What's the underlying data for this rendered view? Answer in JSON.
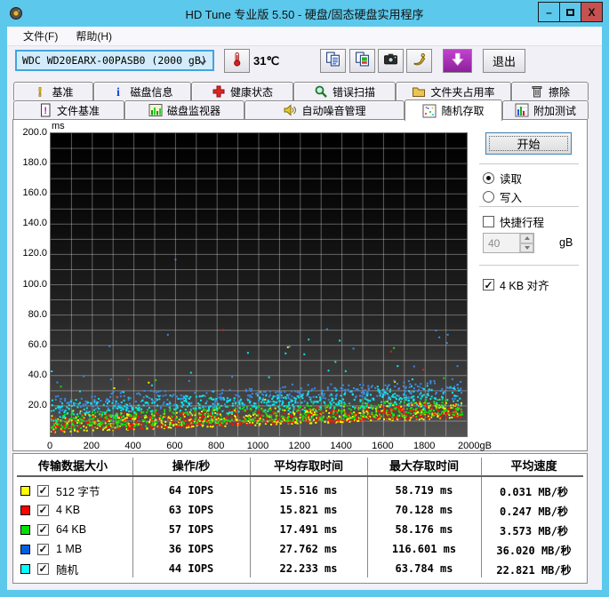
{
  "window": {
    "title": "HD Tune 专业版 5.50 - 硬盘/固态硬盘实用程序",
    "controls": {
      "minimize": "–",
      "maximize": "□",
      "close": "X"
    }
  },
  "menu": {
    "items": [
      "文件(F)",
      "帮助(H)"
    ]
  },
  "toolbar": {
    "drive": "WDC WD20EARX-00PASB0  (2000 gB)",
    "temperature": "31℃",
    "buttons": [
      "copy-text-icon",
      "copy-image-icon",
      "camera-icon",
      "gold-tool-icon",
      "download-icon"
    ],
    "exit_label": "退出"
  },
  "tabs": {
    "row1": [
      {
        "label": "基准",
        "icon": "benchmark-icon",
        "width": 90
      },
      {
        "label": "磁盘信息",
        "icon": "disk-info-icon",
        "width": 110
      },
      {
        "label": "健康状态",
        "icon": "health-icon",
        "width": 115
      },
      {
        "label": "错误扫描",
        "icon": "error-scan-icon",
        "width": 115
      },
      {
        "label": "文件夹占用率",
        "icon": "folder-usage-icon",
        "width": 130
      },
      {
        "label": "擦除",
        "icon": "erase-icon",
        "width": 87
      }
    ],
    "row2": [
      {
        "label": "文件基准",
        "icon": "file-benchmark-icon",
        "width": 125
      },
      {
        "label": "磁盘监视器",
        "icon": "disk-monitor-icon",
        "width": 135
      },
      {
        "label": "自动噪音管理",
        "icon": "aam-icon",
        "width": 180
      },
      {
        "label": "随机存取",
        "icon": "random-access-icon",
        "width": 110,
        "active": true
      },
      {
        "label": "附加测试",
        "icon": "extra-tests-icon",
        "width": 97
      }
    ]
  },
  "controls": {
    "start_label": "开始",
    "read_label": "读取",
    "write_label": "写入",
    "read_selected": true,
    "short_stroke_label": "快捷行程",
    "short_stroke_checked": false,
    "short_stroke_value": "40",
    "short_stroke_unit": "gB",
    "align_label": "4 KB 对齐",
    "align_checked": true
  },
  "chart_data": {
    "type": "scatter",
    "title": "随机存取：存取时间 (ms) vs 磁盘位置 (gB)",
    "xlabel": "gB",
    "ylabel": "ms",
    "xlim": [
      0,
      2000
    ],
    "ylim": [
      0,
      200
    ],
    "grid": {
      "x_step": 100,
      "y_step": 10,
      "color": "rgba(255,255,255,0.34)"
    },
    "x_tick_values": [
      0,
      200,
      400,
      600,
      800,
      1000,
      1200,
      1400,
      1600,
      1800,
      2000
    ],
    "x_tick_labels": [
      "0",
      "200",
      "400",
      "600",
      "800",
      "1000",
      "1200",
      "1400",
      "1600",
      "1800",
      "2000gB"
    ],
    "y_tick_labels": [
      "200.0",
      "180.0",
      "160.0",
      "140.0",
      "120.0",
      "100.0",
      "80.0",
      "60.0",
      "40.0",
      "20.0"
    ],
    "envelope": {
      "start_ms": 2.5,
      "end_ms": 12
    },
    "seed": 20121225,
    "series": [
      {
        "name": "512 字节",
        "color": "#f6f600",
        "count": 560,
        "band_low": 0,
        "band_high": 11,
        "dist": "pow",
        "outlier_rate": 0.012,
        "outlier_max": 24,
        "iops": 64,
        "avg_access_ms": 15.516,
        "max_access_ms": 58.719,
        "avg_speed_MBps": 0.031,
        "max_point": {
          "x": 1140,
          "y": 58.7
        }
      },
      {
        "name": "4 KB",
        "color": "#f81800",
        "count": 560,
        "band_low": 0.5,
        "band_high": 11,
        "dist": "pow",
        "outlier_rate": 0.012,
        "outlier_max": 38,
        "iops": 63,
        "avg_access_ms": 15.821,
        "max_access_ms": 70.128,
        "avg_speed_MBps": 0.247,
        "max_point": {
          "x": 830,
          "y": 70.1
        }
      },
      {
        "name": "64 KB",
        "color": "#14dc14",
        "count": 520,
        "band_low": 2,
        "band_high": 13,
        "dist": "pow",
        "outlier_rate": 0.015,
        "outlier_max": 38,
        "iops": 57,
        "avg_access_ms": 17.491,
        "max_access_ms": 58.176,
        "avg_speed_MBps": 3.573,
        "max_point": {
          "x": 1650,
          "y": 58.2
        }
      },
      {
        "name": "1 MB",
        "color": "#3a8ae6",
        "count": 430,
        "band_low": 11,
        "band_high": 27,
        "dist": "mean",
        "outlier_rate": 0.05,
        "outlier_max": 42,
        "iops": 36,
        "avg_access_ms": 27.762,
        "max_access_ms": 116.601,
        "avg_speed_MBps": 36.02,
        "max_point": {
          "x": 600,
          "y": 116.6
        }
      },
      {
        "name": "随机",
        "color": "#10e6e6",
        "count": 470,
        "band_low": 7,
        "band_high": 23,
        "dist": "mean",
        "outlier_rate": 0.035,
        "outlier_max": 36,
        "iops": 44,
        "avg_access_ms": 22.233,
        "max_access_ms": 63.784,
        "avg_speed_MBps": 22.821,
        "max_point": {
          "x": 1240,
          "y": 63.8
        }
      }
    ]
  },
  "table": {
    "headers": [
      "传输数据大小",
      "操作/秒",
      "平均存取时间",
      "最大存取时间",
      "平均速度"
    ],
    "rows": [
      {
        "color": "#ffff00",
        "checked": true,
        "label": "512 字节",
        "iops": "64 IOPS",
        "avg": "15.516 ms",
        "max": "58.719 ms",
        "speed": "0.031 MB/秒"
      },
      {
        "color": "#ff0000",
        "checked": true,
        "label": "4 KB",
        "iops": "63 IOPS",
        "avg": "15.821 ms",
        "max": "70.128 ms",
        "speed": "0.247 MB/秒"
      },
      {
        "color": "#00e000",
        "checked": true,
        "label": "64 KB",
        "iops": "57 IOPS",
        "avg": "17.491 ms",
        "max": "58.176 ms",
        "speed": "3.573 MB/秒"
      },
      {
        "color": "#0060e0",
        "checked": true,
        "label": "1 MB",
        "iops": "36 IOPS",
        "avg": "27.762 ms",
        "max": "116.601 ms",
        "speed": "36.020 MB/秒"
      },
      {
        "color": "#00ffff",
        "checked": true,
        "label": "随机",
        "iops": "44 IOPS",
        "avg": "22.233 ms",
        "max": "63.784 ms",
        "speed": "22.821 MB/秒"
      }
    ]
  },
  "colors": {
    "frame": "#5cc9ec",
    "close_button": "#c75050",
    "client_bg": "#f1f0f6",
    "plot_top": "#000000",
    "plot_bottom": "#525252"
  }
}
